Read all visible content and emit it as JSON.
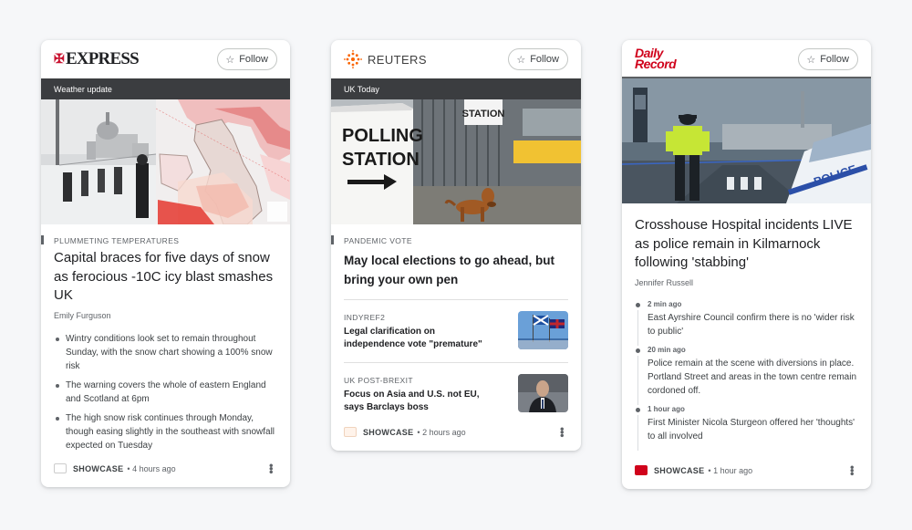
{
  "cards": [
    {
      "publisher": "EXPRESS",
      "follow_label": "Follow",
      "section": "Weather update",
      "kicker": "PLUMMETING TEMPERATURES",
      "title": "Capital braces for five days of snow as ferocious -10C icy blast smashes UK",
      "author": "Emily Furguson",
      "bullets": [
        "Wintry conditions look set to remain throughout Sunday, with the snow chart showing a 100% snow risk",
        "The warning covers the whole of eastern England and Scotland at 6pm",
        "The high snow risk continues through Monday, though easing slightly in the southeast with snowfall expected on Tuesday"
      ],
      "footer_label": "SHOWCASE",
      "footer_time": "4 hours ago",
      "icon": "crusader-icon"
    },
    {
      "publisher": "REUTERS",
      "follow_label": "Follow",
      "section": "UK Today",
      "image_sign": "POLLING\nSTATION",
      "image_sign_top": "STATION",
      "kicker": "PANDEMIC VOTE",
      "title": "May local elections to go ahead, but bring your own pen",
      "substories": [
        {
          "kicker": "INDYREF2",
          "title": "Legal clarification on independence vote \"premature\""
        },
        {
          "kicker": "UK POST-BREXIT",
          "title": "Focus on Asia and U.S. not EU, says Barclays boss"
        }
      ],
      "footer_label": "SHOWCASE",
      "footer_time": "2 hours ago"
    },
    {
      "publisher_line1": "Daily",
      "publisher_line2": "Record",
      "follow_label": "Follow",
      "image_van": "POLICE",
      "title": "Crosshouse Hospital incidents LIVE as police remain in Kilmarnock following 'stabbing'",
      "author": "Jennifer Russell",
      "timeline": [
        {
          "ago": "2 min ago",
          "text": "East Ayrshire Council confirm there is no 'wider risk to public'"
        },
        {
          "ago": "20 min ago",
          "text": "Police remain at the scene with diversions in place. Portland Street and areas in the town centre remain cordoned off."
        },
        {
          "ago": "1 hour ago",
          "text": "First Minister Nicola Sturgeon offered her 'thoughts' to all involved"
        }
      ],
      "footer_label": "SHOWCASE",
      "footer_time": "1 hour ago"
    }
  ],
  "colors": {
    "express_red": "#c8102e",
    "reuters_orange": "#fa6400",
    "record_red": "#d0021b",
    "section_bar": "#3b3d40"
  },
  "icons": {
    "follow": "star-icon",
    "more": "more-vert-icon"
  }
}
